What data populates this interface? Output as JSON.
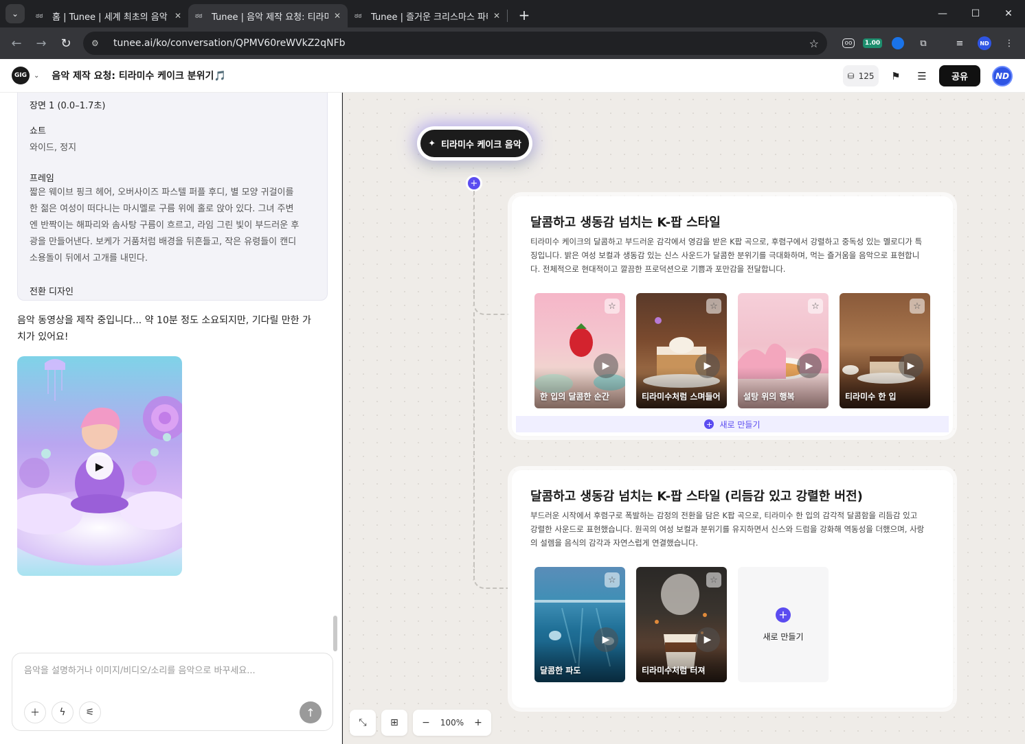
{
  "browser": {
    "tabs": [
      {
        "title": "홈 | Tunee | 세계 최초의 음악 (",
        "active": false
      },
      {
        "title": "Tunee | 음악 제작 요청: 티라미",
        "active": true
      },
      {
        "title": "Tunee | 즐거운 크리스마스 파티",
        "active": false
      }
    ],
    "url": "tunee.ai/ko/conversation/QPMV60reWVkZ2qNFb",
    "ext_badge": "1.00"
  },
  "header": {
    "logo": "GIG",
    "conversation_title": "음악 제작 요청: 티라미수 케이크 분위기🎵",
    "credits": "125",
    "share_label": "공유",
    "avatar_initials": "ND"
  },
  "left": {
    "scene_title": "장면 1 (0.0–1.7초)",
    "shot_label": "쇼트",
    "shot_value": "와이드, 정지",
    "frame_label": "프레임",
    "frame_lines": [
      "짧은 웨이브 핑크 헤어, 오버사이즈 파스텔 퍼플 후디, 별 모양 귀걸이를",
      "한 젊은 여성이 떠다니는 마시멜로 구름 위에 홀로 앉아 있다. 그녀 주변",
      "엔 반짝이는 해파리와 솜사탕 구름이 흐르고, 라임 그린 빛이 부드러운 후",
      "광을 만들어낸다. 보케가 거품처럼 배경을 뒤흔들고, 작은 유령들이 캔디",
      "소용돌이 뒤에서 고개를 내민다."
    ],
    "transition_label": "전환 디자인",
    "producing_lines": [
      "음악 동영상을 제작 중입니다... 약 10분 정도 소요되지만, 기다릴 만한 가",
      "치가 있어요!"
    ],
    "composer_placeholder": "음악을 설명하거나 이미지/비디오/소리를 음악으로 바꾸세요..."
  },
  "canvas": {
    "root_label": "티라미수 케이크 음악",
    "zoom_level": "100%",
    "cards": [
      {
        "title": "달콤하고 생동감 넘치는 K-팝 스타일",
        "desc_lines": [
          "티라미수 케이크의 달콤하고 부드러운 감각에서 영감을 받은 K팝 곡으로, 후렴구에서 강렬하고 중독성 있는 멜로디가 특",
          "징입니다. 밝은 여성 보컬과 생동감 있는 신스 사운드가 달콤한 분위기를 극대화하며, 먹는 즐거움을 음악으로 표현합니",
          "다. 전체적으로 현대적이고 깔끔한 프로덕션으로 기쁨과 포만감을 전달합니다."
        ],
        "tracks": [
          "한 입의 달콤한 순간",
          "티라미수처럼 스며들어",
          "설탕 위의 행복",
          "티라미수 한 입"
        ],
        "new_label": "새로 만들기"
      },
      {
        "title": "달콤하고 생동감 넘치는 K-팝 스타일 (리듬감 있고 강렬한 버전)",
        "desc_lines": [
          "부드러운 시작에서 후렴구로 폭발하는 감정의 전환을 담은 K팝 곡으로, 티라미수 한 입의 감각적 달콤함을 리듬감 있고",
          "강렬한 사운드로 표현했습니다. 원곡의 여성 보컬과 분위기를 유지하면서 신스와 드럼을 강화해 역동성을 더했으며, 사랑",
          "의 설렘을 음식의 감각과 자연스럽게 연결했습니다."
        ],
        "tracks": [
          "달콤한 파도",
          "티라미수처럼 터져"
        ],
        "new_label": "새로 만들기"
      }
    ]
  }
}
